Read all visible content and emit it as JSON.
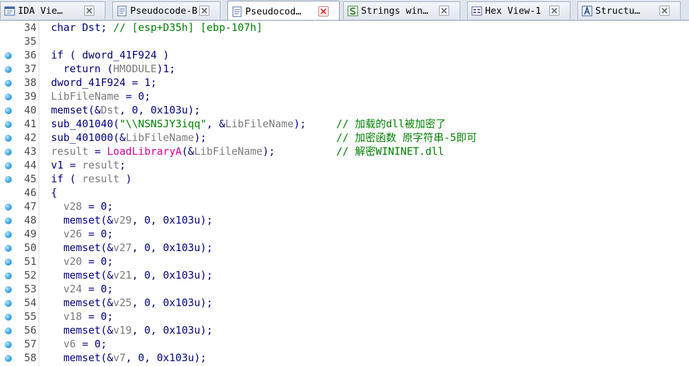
{
  "tabs": [
    {
      "label": "IDA Vie…",
      "icon": "ida-view-icon",
      "active": false
    },
    {
      "label": "Pseudocode-B",
      "icon": "pseudocode-icon",
      "active": false
    },
    {
      "label": "Pseudocod…",
      "icon": "pseudocode-icon",
      "active": true
    },
    {
      "label": "Strings win…",
      "icon": "strings-icon",
      "active": false
    },
    {
      "label": "Hex View-1",
      "icon": "hex-view-icon",
      "active": false
    },
    {
      "label": "Structu…",
      "icon": "structures-icon",
      "active": false
    }
  ],
  "colors": {
    "keyword": "#000080",
    "variable": "#000080",
    "gray_variable": "#7b7b7b",
    "string": "#008000",
    "comment": "#008000",
    "import": "#e0009a",
    "breakpoint": "#3aa6ea"
  },
  "code": {
    "lines": [
      {
        "num": "34",
        "dot": false,
        "indent": 0,
        "tokens": [
          [
            "kw",
            "char Dst; "
          ],
          [
            "cmt",
            "// [esp+D35h] [ebp-107h]"
          ]
        ]
      },
      {
        "num": "35",
        "dot": false,
        "indent": 0,
        "tokens": []
      },
      {
        "num": "36",
        "dot": true,
        "indent": 0,
        "tokens": [
          [
            "kw",
            "if ( dword_41F924 )"
          ]
        ]
      },
      {
        "num": "37",
        "dot": true,
        "indent": 1,
        "tokens": [
          [
            "kw",
            "return ("
          ],
          [
            "gray",
            "HMODULE"
          ],
          [
            "kw",
            ")1;"
          ]
        ]
      },
      {
        "num": "38",
        "dot": true,
        "indent": 0,
        "tokens": [
          [
            "kw",
            "dword_41F924 = 1;"
          ]
        ]
      },
      {
        "num": "39",
        "dot": true,
        "indent": 0,
        "tokens": [
          [
            "gray",
            "LibFileName"
          ],
          [
            "kw",
            " = 0;"
          ]
        ]
      },
      {
        "num": "40",
        "dot": true,
        "indent": 0,
        "tokens": [
          [
            "kw",
            "memset(&"
          ],
          [
            "gray",
            "Dst"
          ],
          [
            "kw",
            ", 0, 0x103u);"
          ]
        ]
      },
      {
        "num": "41",
        "dot": true,
        "indent": 0,
        "tokens": [
          [
            "kw",
            "sub_401040("
          ],
          [
            "str",
            "\"\\\\NSNSJY3iqq\""
          ],
          [
            "kw",
            ", &"
          ],
          [
            "gray",
            "LibFileName"
          ],
          [
            "kw",
            ");"
          ]
        ],
        "comment": "// 加载的dll被加密了"
      },
      {
        "num": "42",
        "dot": true,
        "indent": 0,
        "tokens": [
          [
            "kw",
            "sub_401000(&"
          ],
          [
            "gray",
            "LibFileName"
          ],
          [
            "kw",
            ");"
          ]
        ],
        "comment": "// 加密函数 原字符串-5即可"
      },
      {
        "num": "43",
        "dot": true,
        "indent": 0,
        "tokens": [
          [
            "gray",
            "result"
          ],
          [
            "kw",
            " = "
          ],
          [
            "imp",
            "LoadLibraryA"
          ],
          [
            "kw",
            "(&"
          ],
          [
            "gray",
            "LibFileName"
          ],
          [
            "kw",
            ");"
          ]
        ],
        "comment": "// 解密WININET.dll"
      },
      {
        "num": "44",
        "dot": true,
        "indent": 0,
        "tokens": [
          [
            "kw",
            "v1 = "
          ],
          [
            "gray",
            "result"
          ],
          [
            "kw",
            ";"
          ]
        ]
      },
      {
        "num": "45",
        "dot": true,
        "indent": 0,
        "tokens": [
          [
            "kw",
            "if ( "
          ],
          [
            "gray",
            "result"
          ],
          [
            "kw",
            " )"
          ]
        ]
      },
      {
        "num": "46",
        "dot": false,
        "indent": 0,
        "tokens": [
          [
            "kw",
            "{"
          ]
        ]
      },
      {
        "num": "47",
        "dot": true,
        "indent": 1,
        "tokens": [
          [
            "gray",
            "v28"
          ],
          [
            "kw",
            " = 0;"
          ]
        ]
      },
      {
        "num": "48",
        "dot": true,
        "indent": 1,
        "tokens": [
          [
            "kw",
            "memset(&"
          ],
          [
            "gray",
            "v29"
          ],
          [
            "kw",
            ", 0, 0x103u);"
          ]
        ]
      },
      {
        "num": "49",
        "dot": true,
        "indent": 1,
        "tokens": [
          [
            "gray",
            "v26"
          ],
          [
            "kw",
            " = 0;"
          ]
        ]
      },
      {
        "num": "50",
        "dot": true,
        "indent": 1,
        "tokens": [
          [
            "kw",
            "memset(&"
          ],
          [
            "gray",
            "v27"
          ],
          [
            "kw",
            ", 0, 0x103u);"
          ]
        ]
      },
      {
        "num": "51",
        "dot": true,
        "indent": 1,
        "tokens": [
          [
            "gray",
            "v20"
          ],
          [
            "kw",
            " = 0;"
          ]
        ]
      },
      {
        "num": "52",
        "dot": true,
        "indent": 1,
        "tokens": [
          [
            "kw",
            "memset(&"
          ],
          [
            "gray",
            "v21"
          ],
          [
            "kw",
            ", 0, 0x103u);"
          ]
        ]
      },
      {
        "num": "53",
        "dot": true,
        "indent": 1,
        "tokens": [
          [
            "gray",
            "v24"
          ],
          [
            "kw",
            " = 0;"
          ]
        ]
      },
      {
        "num": "54",
        "dot": true,
        "indent": 1,
        "tokens": [
          [
            "kw",
            "memset(&"
          ],
          [
            "gray",
            "v25"
          ],
          [
            "kw",
            ", 0, 0x103u);"
          ]
        ]
      },
      {
        "num": "55",
        "dot": true,
        "indent": 1,
        "tokens": [
          [
            "gray",
            "v18"
          ],
          [
            "kw",
            " = 0;"
          ]
        ]
      },
      {
        "num": "56",
        "dot": true,
        "indent": 1,
        "tokens": [
          [
            "kw",
            "memset(&"
          ],
          [
            "gray",
            "v19"
          ],
          [
            "kw",
            ", 0, 0x103u);"
          ]
        ]
      },
      {
        "num": "57",
        "dot": true,
        "indent": 1,
        "tokens": [
          [
            "gray",
            "v6"
          ],
          [
            "kw",
            " = 0;"
          ]
        ]
      },
      {
        "num": "58",
        "dot": true,
        "indent": 1,
        "tokens": [
          [
            "kw",
            "memset(&"
          ],
          [
            "gray",
            "v7"
          ],
          [
            "kw",
            ", 0, 0x103u);"
          ]
        ]
      }
    ]
  }
}
